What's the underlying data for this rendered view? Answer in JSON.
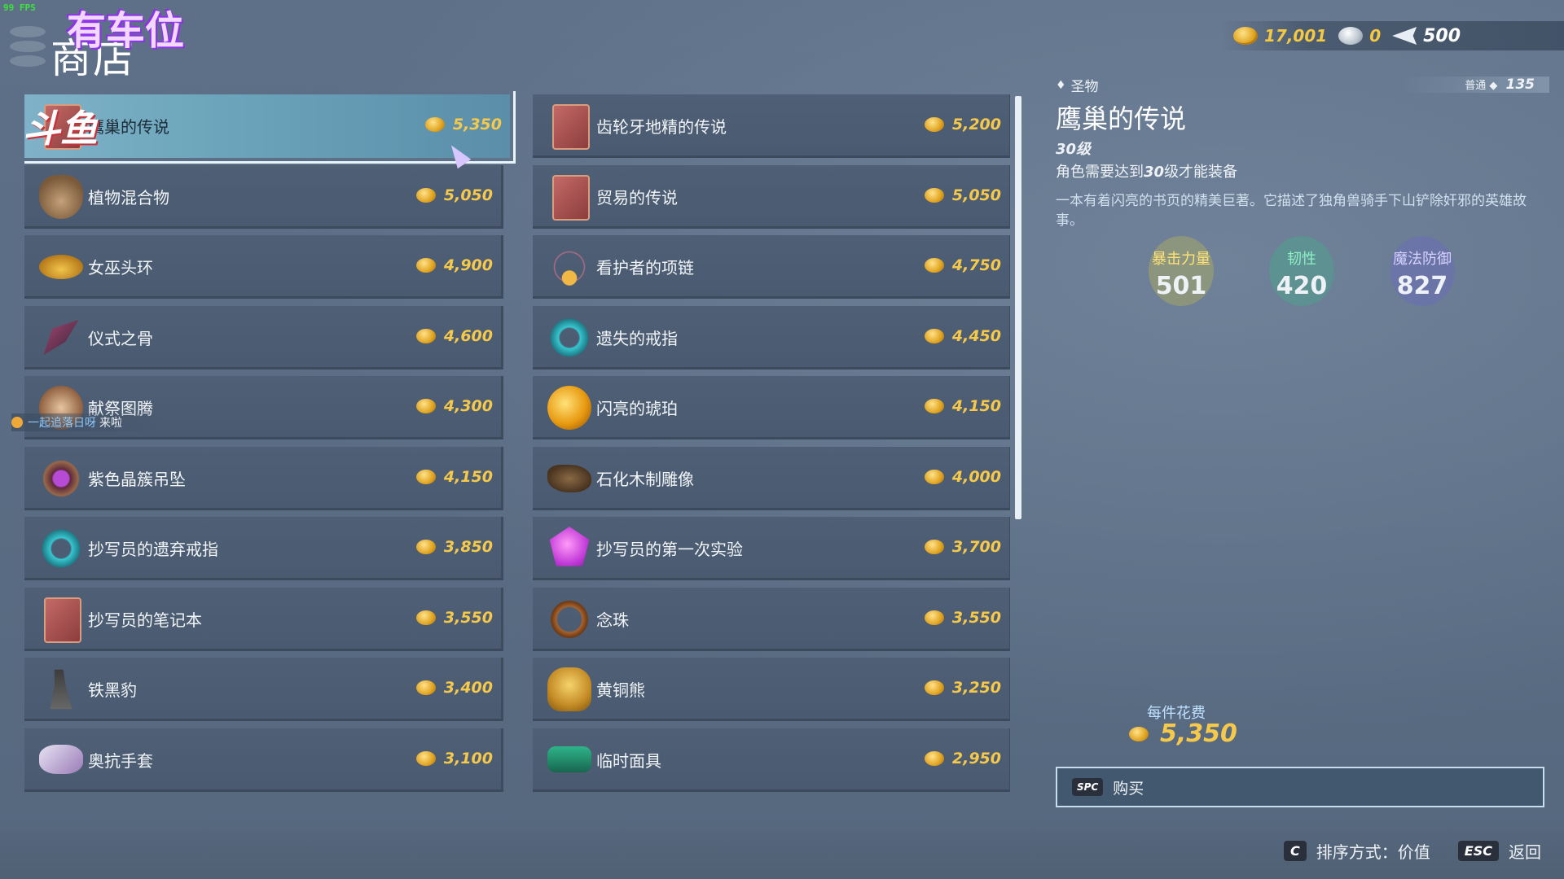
{
  "fps": "99 FPS",
  "watermark": "有车位",
  "title": "商店",
  "currency": [
    {
      "icon": "gold-coin-icon",
      "value": "17,001"
    },
    {
      "icon": "silver-coin-icon",
      "value": "0"
    },
    {
      "icon": "ticket-icon",
      "value": "500"
    }
  ],
  "items": [
    {
      "name": "鹰巢的传说",
      "price": "5,350",
      "icon": "book"
    },
    {
      "name": "齿轮牙地精的传说",
      "price": "5,200",
      "icon": "book"
    },
    {
      "name": "植物混合物",
      "price": "5,050",
      "icon": "bag"
    },
    {
      "name": "贸易的传说",
      "price": "5,050",
      "icon": "book"
    },
    {
      "name": "女巫头环",
      "price": "4,900",
      "icon": "tiara"
    },
    {
      "name": "看护者的项链",
      "price": "4,750",
      "icon": "necklace"
    },
    {
      "name": "仪式之骨",
      "price": "4,600",
      "icon": "bone"
    },
    {
      "name": "遗失的戒指",
      "price": "4,450",
      "icon": "ring-teal"
    },
    {
      "name": "献祭图腾",
      "price": "4,300",
      "icon": "idol"
    },
    {
      "name": "闪亮的琥珀",
      "price": "4,150",
      "icon": "amber"
    },
    {
      "name": "紫色晶簇吊坠",
      "price": "4,150",
      "icon": "pendant"
    },
    {
      "name": "石化木制雕像",
      "price": "4,000",
      "icon": "wood"
    },
    {
      "name": "抄写员的遗弃戒指",
      "price": "3,850",
      "icon": "ring-teal"
    },
    {
      "name": "抄写员的第一次实验",
      "price": "3,700",
      "icon": "gem"
    },
    {
      "name": "抄写员的笔记本",
      "price": "3,550",
      "icon": "book"
    },
    {
      "name": "念珠",
      "price": "3,550",
      "icon": "beads"
    },
    {
      "name": "铁黑豹",
      "price": "3,400",
      "icon": "cat"
    },
    {
      "name": "黄铜熊",
      "price": "3,250",
      "icon": "bear"
    },
    {
      "name": "奥抗手套",
      "price": "3,100",
      "icon": "glove"
    },
    {
      "name": "临时面具",
      "price": "2,950",
      "icon": "mask"
    }
  ],
  "selected_badge": "斗鱼",
  "chat": {
    "user": "一起追落日呀",
    "message": "来啦"
  },
  "detail": {
    "category": "圣物",
    "rarity_label": "普通",
    "rarity_value": "135",
    "title": "鹰巢的传说",
    "level": "30级",
    "requirement_prefix": "角色需要达到",
    "requirement_level": "30",
    "requirement_suffix": "级才能装备",
    "description": "一本有着闪亮的书页的精美巨著。它描述了独角兽骑手下山铲除奸邪的英雄故事。",
    "stats": [
      {
        "label": "暴击力量",
        "value": "501",
        "color": "#c5b94a"
      },
      {
        "label": "韧性",
        "value": "420",
        "color": "#3fb38a"
      },
      {
        "label": "魔法防御",
        "value": "827",
        "color": "#6e63c9"
      }
    ],
    "cost_label": "每件花费",
    "cost_value": "5,350",
    "buy_key": "SPC",
    "buy_label": "购买"
  },
  "bottom": {
    "sort_key": "C",
    "sort_label": "排序方式：价值",
    "back_key": "ESC",
    "back_label": "返回"
  }
}
